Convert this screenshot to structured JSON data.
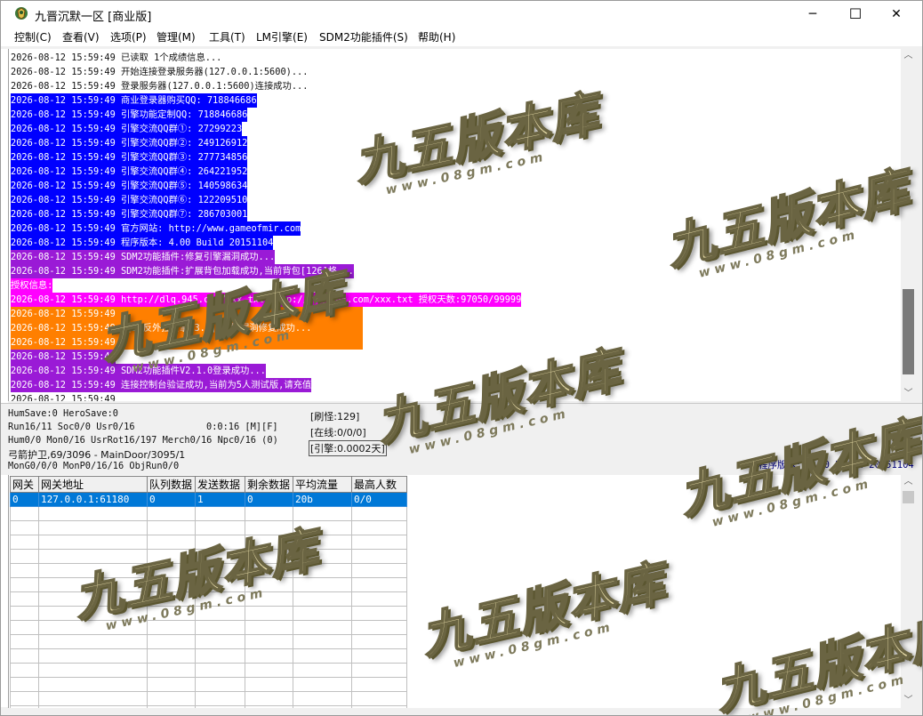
{
  "window": {
    "title": "九晋沉默一区 [商业版]",
    "minimize": "─",
    "maximize": "☐",
    "close": "✕",
    "app_icon": "hero-shield-icon"
  },
  "menu": [
    "控制(C)",
    "查看(V)",
    "选项(P)",
    "管理(M)",
    "工具(T)",
    "LM引擎(E)",
    "SDM2功能插件(S)",
    "帮助(H)"
  ],
  "log_lines": [
    {
      "text": "2026-08-12 15:59:49 已读取 1个成绩信息...",
      "style": "plain"
    },
    {
      "text": "2026-08-12 15:59:49 开始连接登录服务器(127.0.0.1:5600)...",
      "style": "plain"
    },
    {
      "text": "2026-08-12 15:59:49 登录服务器(127.0.0.1:5600)连接成功...",
      "style": "plain"
    },
    {
      "text": "2026-08-12 15:59:49 商业登录器购买QQ: 718846686",
      "style": "blue"
    },
    {
      "text": "2026-08-12 15:59:49 引擎功能定制QQ: 718846686",
      "style": "blue"
    },
    {
      "text": "2026-08-12 15:59:49 引擎交流QQ群①: 27299223",
      "style": "blue"
    },
    {
      "text": "2026-08-12 15:59:49 引擎交流QQ群②: 249126912",
      "style": "blue"
    },
    {
      "text": "2026-08-12 15:59:49 引擎交流QQ群③: 277734856",
      "style": "blue"
    },
    {
      "text": "2026-08-12 15:59:49 引擎交流QQ群④: 264221952",
      "style": "blue"
    },
    {
      "text": "2026-08-12 15:59:49 引擎交流QQ群⑤: 140598634",
      "style": "blue"
    },
    {
      "text": "2026-08-12 15:59:49 引擎交流QQ群⑥: 122209510",
      "style": "blue"
    },
    {
      "text": "2026-08-12 15:59:49 引擎交流QQ群⑦: 286703001",
      "style": "blue"
    },
    {
      "text": "2026-08-12 15:59:49 官方网站: http://www.gameofmir.com",
      "style": "blue"
    },
    {
      "text": "2026-08-12 15:59:49 程序版本: 4.00 Build 20151104",
      "style": "blue"
    },
    {
      "text": "2026-08-12 15:59:49 SDM2功能插件:修复引擎漏洞成功...",
      "style": "purple"
    },
    {
      "text": "2026-08-12 15:59:49 SDM2功能插件:扩展背包加载成功,当前背包[126]格...",
      "style": "purple"
    },
    {
      "text": "授权信息:",
      "style": "magenta"
    },
    {
      "text": "2026-08-12 15:59:49 http://dlq.945.com/xxx.txt http://dlq.945.com/xxx.txt 授权天数:97050/99999",
      "style": "magenta"
    },
    {
      "text": "2026-08-12 15:59:49 ",
      "style": "orange"
    },
    {
      "text": "2026-08-12 15:59:49 ★[LM反外挂引擎v3.6]:引擎漏洞修复成功...",
      "style": "orange"
    },
    {
      "text": "2026-08-12 15:59:49 ",
      "style": "orange"
    },
    {
      "text": "2026-08-12 15:59:49 ",
      "style": "purple"
    },
    {
      "text": "2026-08-12 15:59:49 SDM2功能插件V2.1.0登录成功...",
      "style": "purple"
    },
    {
      "text": "2026-08-12 15:59:49 连接控制台验证成功,当前为5人测试版,请充值",
      "style": "purple"
    },
    {
      "text": "2026-08-12 15:59:49 ",
      "style": "plain"
    }
  ],
  "status": {
    "save": "HumSave:0 HeroSave:0",
    "run": "Run16/11 Soc0/0 Usr0/16",
    "timer": "0:0:16 [M][F]",
    "counts": "Hum0/0 Mon0/16 UsrRot16/197 Merch0/16 Npc0/16 (0)",
    "guard": "弓箭护卫,69/3096 - MainDoor/3095/1",
    "mon": "MonG0/0/0 MonP0/16/16 ObjRun0/0",
    "refresh": "[刷怪:129]",
    "online": "[在线:0/0/0]",
    "engine": "[引擎:0.0002天]",
    "version": "程序版本: 4.00 Build 20151104"
  },
  "grid": {
    "headers": [
      "网关",
      "网关地址",
      "队列数据",
      "发送数据",
      "剩余数据",
      "平均流量",
      "最高人数"
    ],
    "rows": [
      [
        "0",
        "127.0.0.1:61180",
        "0",
        "1",
        "0",
        "20b",
        "0/0"
      ]
    ]
  },
  "watermark": {
    "big": "九五版本库",
    "small": "www.08gm.com"
  }
}
